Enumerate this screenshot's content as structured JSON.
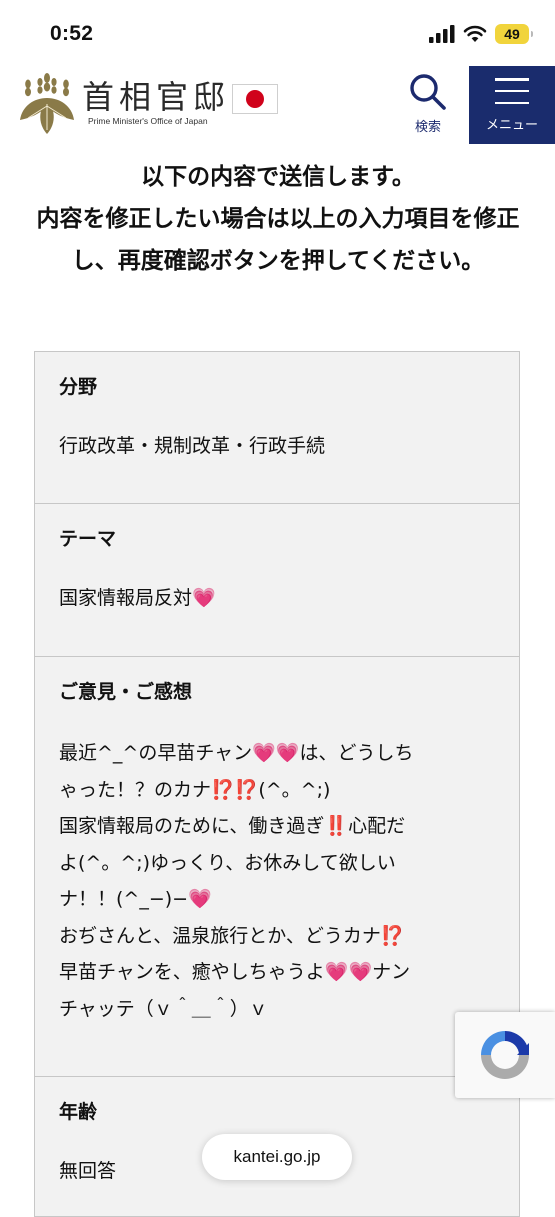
{
  "status_bar": {
    "time": "0:52",
    "battery": "49"
  },
  "header": {
    "logo_title": "首相官邸",
    "logo_subtitle": "Prime Minister's Office of Japan",
    "search_label": "検索",
    "menu_label": "メニュー",
    "icons": {
      "crest": "paulownia-crest-icon",
      "flag": "japan-flag-icon",
      "search": "search-icon",
      "menu": "hamburger-menu-icon"
    },
    "colors": {
      "menu_background": "#1a2c6d",
      "search_icon": "#1c2a6e",
      "flag_sun": "#d0021b"
    }
  },
  "notice": {
    "line1": "以下の内容で送信します。",
    "line2": "内容を修正したい場合は以上の入力項目を修正し、再度確認ボタンを押してください。"
  },
  "fields": [
    {
      "label": "分野",
      "value": "行政改革・規制改革・行政手続"
    },
    {
      "label": "テーマ",
      "value": "国家情報局反対💗"
    },
    {
      "label": "ご意見・ご感想",
      "value": "最近^_^の早苗チャン💗💗は、どうしち\nゃった！？のカナ⁉️⁉️(^。^;)\n国家情報局のために、働き過ぎ‼️心配だ\nよ(^。^;)ゆっくり、お休みして欲しい\nナ！！(^_−)−💗\nおぢさんと、温泉旅行とか、どうカナ⁉️\n早苗チャンを、癒やしちゃうよ💗💗ナン\nチャッテ（ｖ＾＿＾）ｖ"
    },
    {
      "label": "年齢",
      "value": "無回答"
    }
  ],
  "recaptcha": {
    "icon": "recaptcha-icon"
  },
  "browser": {
    "url": "kantei.go.jp"
  }
}
